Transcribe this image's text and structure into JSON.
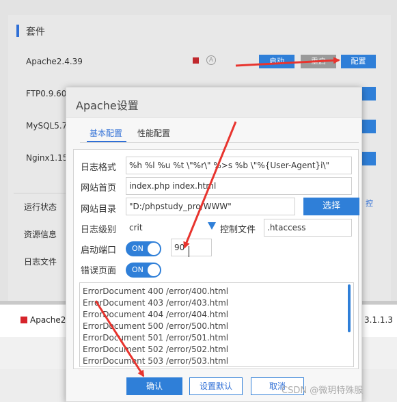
{
  "background": {
    "section_title": "套件",
    "suites": [
      {
        "name": "Apache2.4.39"
      },
      {
        "name": "FTP0.9.60"
      },
      {
        "name": "MySQL5.7"
      },
      {
        "name": "Nginx1.15"
      }
    ],
    "apache_buttons": {
      "start": "启动",
      "restart": "重启",
      "config": "配置"
    },
    "status_icon": "circle-a-icon",
    "nav": [
      "运行状态",
      "资源信息",
      "日志文件"
    ],
    "right_link": "控",
    "taskbar": {
      "label": "Apache2",
      "version": "3.1.1.3"
    }
  },
  "dialog": {
    "title": "Apache设置",
    "tabs": [
      "基本配置",
      "性能配置"
    ],
    "active_tab": 0,
    "fields": {
      "log_format_label": "日志格式",
      "log_format_value": "%h %l %u %t \\\"%r\\\" %>s %b \\\"%{User-Agent}i\\\"",
      "homepage_label": "网站首页",
      "homepage_value": "index.php index.html",
      "dir_label": "网站目录",
      "dir_value": "\"D:/phpstudy_pro/WWW\"",
      "select_button": "选择",
      "log_level_label": "日志级别",
      "log_level_value": "crit",
      "control_file_label": "控制文件",
      "control_file_value": ".htaccess",
      "port_label": "启动端口",
      "port_toggle": "ON",
      "port_value": "90",
      "error_page_label": "错误页面",
      "error_toggle": "ON"
    },
    "error_documents": [
      "ErrorDocument 400 /error/400.html",
      "ErrorDocument 403 /error/403.html",
      "ErrorDocument 404 /error/404.html",
      "ErrorDocument 500 /error/500.html",
      "ErrorDocument 501 /error/501.html",
      "ErrorDocument 502 /error/502.html",
      "ErrorDocument 503 /error/503.html"
    ],
    "buttons": {
      "confirm": "确认",
      "defaults": "设置默认",
      "cancel": "取消"
    }
  },
  "watermark": "CSDN @微玥特殊服",
  "colors": {
    "accent": "#2f7fd8",
    "arrow": "#e8342e",
    "stop": "#c0282d"
  }
}
